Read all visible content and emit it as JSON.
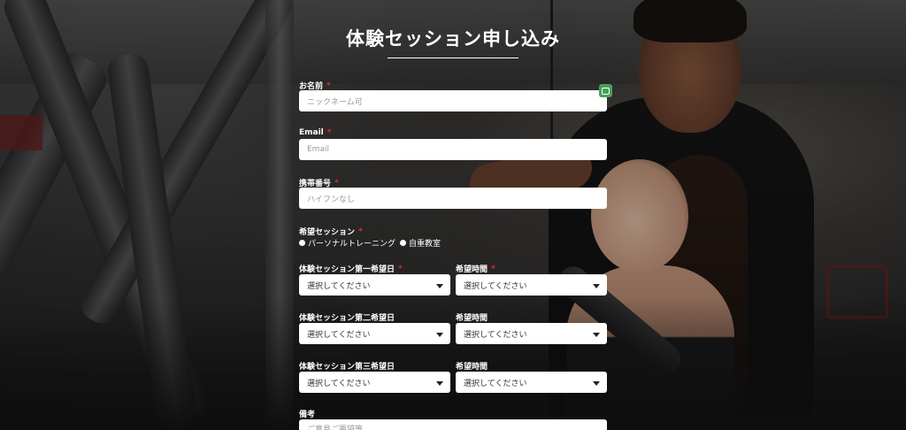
{
  "form": {
    "title": "体験セッション申し込み",
    "name": {
      "label": "お名前",
      "required_mark": "*",
      "placeholder": "ニックネーム可"
    },
    "email": {
      "label": "Email",
      "required_mark": "*",
      "placeholder": "Email"
    },
    "phone": {
      "label": "携帯番号",
      "required_mark": "*",
      "placeholder": "ハイフンなし"
    },
    "session": {
      "label": "希望セッション",
      "required_mark": "*",
      "options": [
        "パーソナルトレーニング",
        "自重教室"
      ]
    },
    "date1": {
      "label": "体験セッション第一希望日",
      "required_mark": "*",
      "value": "選択してください"
    },
    "time1": {
      "label": "希望時間",
      "required_mark": "*",
      "value": "選択してください"
    },
    "date2": {
      "label": "体験セッション第二希望日",
      "value": "選択してください"
    },
    "time2": {
      "label": "希望時間",
      "value": "選択してください"
    },
    "date3": {
      "label": "体験セッション第三希望日",
      "value": "選択してください"
    },
    "time3": {
      "label": "希望時間",
      "value": "選択してください"
    },
    "notes": {
      "label": "備考",
      "placeholder": "ご意見ご要望等"
    }
  },
  "icons": {
    "autofill": "autofill-icon",
    "dropdown": "chevron-down-icon"
  },
  "colors": {
    "required": "#e02a2a",
    "autofill_badge": "#49a05b"
  }
}
